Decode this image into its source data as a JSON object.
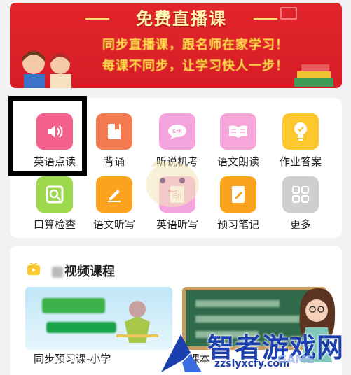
{
  "banner": {
    "title": "免费直播课",
    "line1": "同步直播课，跟名师在家学习！",
    "line2": "每课不同步，让学习快人一步！"
  },
  "grid": {
    "items": [
      {
        "label": "英语点读",
        "icon": "speaker-icon",
        "color": "#f4608c"
      },
      {
        "label": "背诵",
        "icon": "bookmark-book-icon",
        "color": "#f47a52"
      },
      {
        "label": "听说机考",
        "icon": "chat-bubble-icon",
        "color": "#f3a4dc"
      },
      {
        "label": "语文朗读",
        "icon": "open-book-icon",
        "color": "#f6a6d8"
      },
      {
        "label": "作业答案",
        "icon": "lightbulb-icon",
        "color": "#fdc72e"
      },
      {
        "label": "口算检查",
        "icon": "magnifier-frame-icon",
        "color": "#9bd84c"
      },
      {
        "label": "语文听写",
        "icon": "pencil-icon",
        "color": "#fba21f"
      },
      {
        "label": "英语听写",
        "icon": "en-card-icon",
        "color": "#f3a4dc"
      },
      {
        "label": "预习笔记",
        "icon": "notebook-icon",
        "color": "#fba21f"
      },
      {
        "label": "更多",
        "icon": "grid-apps-icon",
        "color": "#cfcfcf"
      }
    ]
  },
  "video": {
    "section_title": "视频课程",
    "courses": [
      {
        "caption": "同步预习课-小学"
      },
      {
        "caption": "课本"
      }
    ]
  },
  "watermark": {
    "title": "智者游戏网",
    "url": "zzslyxcfy.com",
    "game": "GAME"
  },
  "colors": {
    "banner_red": "#e3262d",
    "banner_gold": "#ffe84a",
    "highlight_border": "#000000",
    "watermark_blue": "#1b3fae"
  }
}
